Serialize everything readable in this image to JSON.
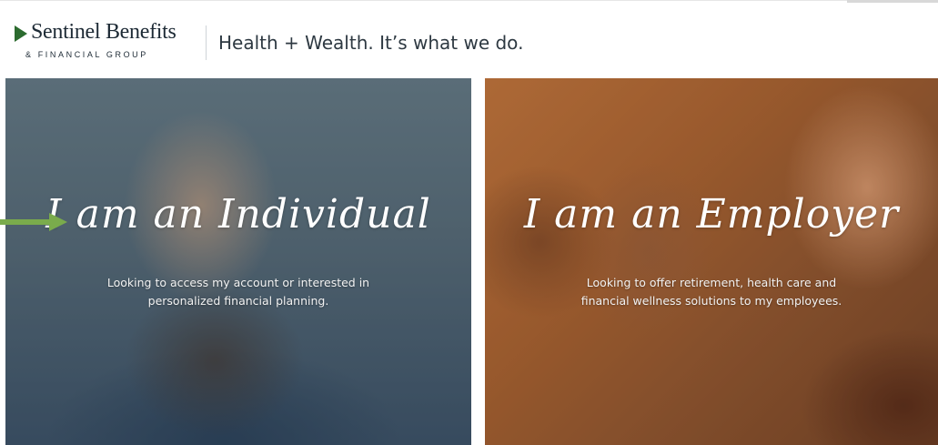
{
  "header": {
    "logo_name": "Sentinel Benefits",
    "logo_sub": "& FINANCIAL GROUP",
    "tagline": "Health + Wealth. It’s what we do."
  },
  "panels": [
    {
      "id": "individual",
      "heading": "I am an Individual",
      "description_lines": [
        "Looking to access my account or interested in",
        "personalized financial planning."
      ]
    },
    {
      "id": "employer",
      "heading": "I am an Employer",
      "description_lines": [
        "Looking to offer retirement, health care and",
        "financial wellness solutions to my employees."
      ]
    }
  ],
  "colors": {
    "logo_green": "#2c6b2f",
    "arrow_green": "#7aab4c",
    "text_dark": "#2e3942"
  },
  "icons": {
    "logo_mark": "triangle-play-icon",
    "pointer": "arrow-right-icon"
  }
}
